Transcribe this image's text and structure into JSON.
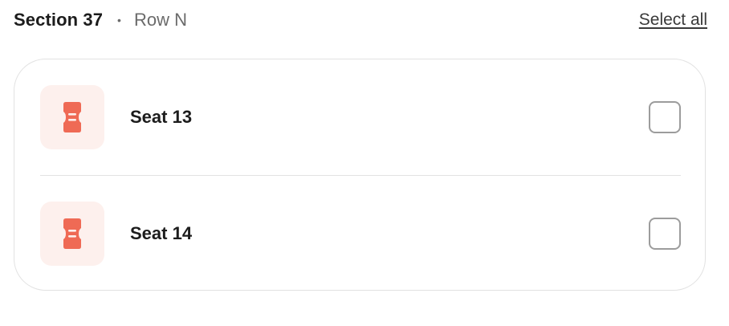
{
  "header": {
    "section": "Section 37",
    "separator": "•",
    "row": "Row N",
    "select_all": "Select all"
  },
  "seats": [
    {
      "label": "Seat 13",
      "icon": "ticket-icon",
      "checked": false
    },
    {
      "label": "Seat 14",
      "icon": "ticket-icon",
      "checked": false
    }
  ],
  "colors": {
    "accent": "#ef6a55",
    "icon_tile_bg": "#fdf0ed",
    "text_primary": "#1c1c1c",
    "text_secondary": "#6b6b6b",
    "border": "#e2e2e2"
  }
}
